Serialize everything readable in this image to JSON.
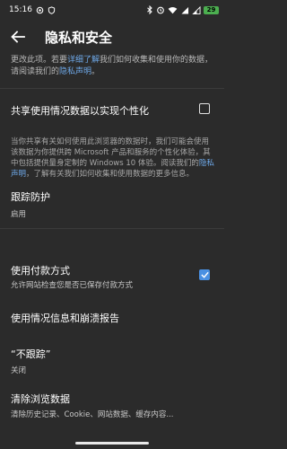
{
  "status": {
    "time": "15:16",
    "battery": "29"
  },
  "header": {
    "title": "隐私和安全"
  },
  "intro": {
    "text_before": "更改此项。若要",
    "link1": "详细了解",
    "text_middle": "我们如何收集和使用你的数据，请阅读我们的",
    "link2": "隐私声明",
    "text_after": "。"
  },
  "personalization": {
    "title": "共享使用情况数据以实现个性化",
    "checked": false,
    "desc_before": "当你共享有关如何使用此浏览器的数据时，我们可能会使用该数据为你提供跨 Microsoft 产品和服务的个性化体验，其中包括提供量身定制的 Windows 10 体验。阅读我们的",
    "desc_link": "隐私声明",
    "desc_after": "，了解有关我们如何收集和使用数据的更多信息。"
  },
  "tracking": {
    "title": "跟踪防护",
    "value": "启用"
  },
  "payment": {
    "title": "使用付款方式",
    "subtitle": "允许网站检查您是否已保存付款方式",
    "checked": true
  },
  "diagnostics": {
    "title": "使用情况信息和崩溃报告"
  },
  "dnt": {
    "title": "“不跟踪”",
    "value": "关闭"
  },
  "clear": {
    "title": "清除浏览数据",
    "subtitle": "清除历史记录、Cookie、网站数据、缓存内容..."
  },
  "icons": {
    "back": "back-arrow-icon",
    "check": "checkmark-icon"
  },
  "colors": {
    "background": "#2b2b2b",
    "accent": "#4a90e2",
    "link": "#6ea8e8",
    "battery": "#4caf50"
  }
}
